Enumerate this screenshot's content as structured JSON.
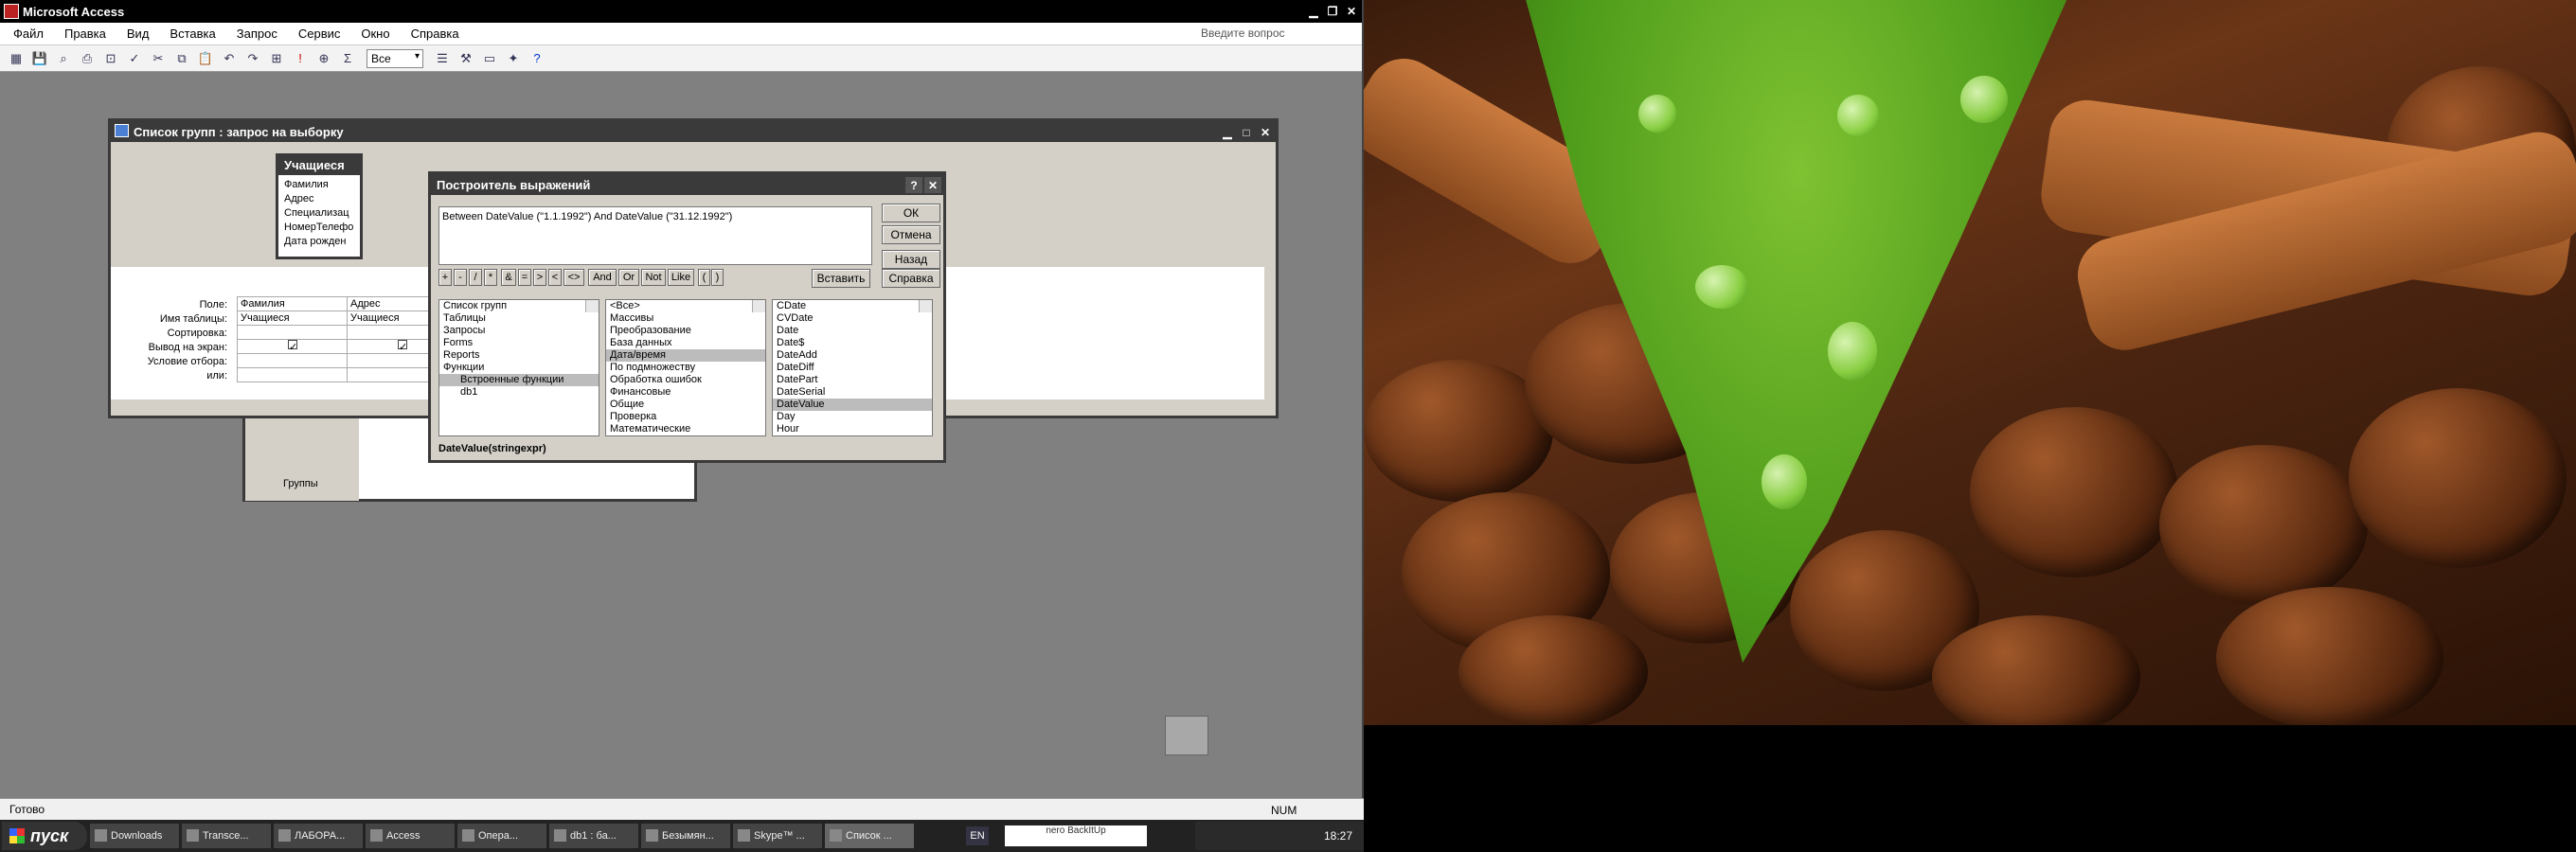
{
  "app": {
    "title": "Microsoft Access",
    "ask_placeholder": "Введите вопрос"
  },
  "menu": [
    "Файл",
    "Правка",
    "Вид",
    "Вставка",
    "Запрос",
    "Сервис",
    "Окно",
    "Справка"
  ],
  "toolbar": {
    "top_values": "Все"
  },
  "query_window": {
    "title": "Список групп : запрос на выборку",
    "table": {
      "name": "Учащиеся",
      "fields": [
        "Фамилия",
        "Адрес",
        "Специализац",
        "НомерТелефо",
        "Дата рожден"
      ]
    },
    "row_labels": [
      "Поле:",
      "Имя таблицы:",
      "Сортировка:",
      "Вывод на экран:",
      "Условие отбора:",
      "или:"
    ],
    "columns": [
      {
        "field": "Фамилия",
        "table": "Учащиеся",
        "show": true
      },
      {
        "field": "Адрес",
        "table": "Учащиеся",
        "show": true
      }
    ]
  },
  "behind_form": {
    "caption": "Группы"
  },
  "builder": {
    "title": "Построитель выражений",
    "expression": "Between DateValue (\"1.1.1992\") And DateValue (\"31.12.1992\")",
    "buttons": {
      "ok": "ОК",
      "cancel": "Отмена",
      "back": "Назад",
      "paste": "Вставить",
      "help": "Справка"
    },
    "operators": [
      "+",
      "-",
      "/",
      "*",
      "&",
      "=",
      ">",
      "<",
      "<>",
      "And",
      "Or",
      "Not",
      "Like",
      "(",
      ")"
    ],
    "folders": [
      "Список групп",
      "Таблицы",
      "Запросы",
      "Forms",
      "Reports",
      "Функции",
      "Встроенные функции",
      "db1"
    ],
    "categories": [
      "<Все>",
      "Массивы",
      "Преобразование",
      "База данных",
      "Дата/время",
      "По подмножеству",
      "Обработка ошибок",
      "Финансовые",
      "Общие",
      "Проверка",
      "Математические"
    ],
    "category_selected": "Дата/время",
    "functions": [
      "CDate",
      "CVDate",
      "Date",
      "Date$",
      "DateAdd",
      "DateDiff",
      "DatePart",
      "DateSerial",
      "DateValue",
      "Day",
      "Hour"
    ],
    "function_selected": "DateValue",
    "syntax": "DateValue(stringexpr)"
  },
  "status": {
    "text": "Готово",
    "num": "NUM"
  },
  "taskbar": {
    "start": "пуск",
    "tasks": [
      "Downloads",
      "Transce...",
      "ЛАБОРА...",
      "Access",
      "Опера...",
      "db1 : ба...",
      "Безымян...",
      "Skype™ ...",
      "Список ..."
    ],
    "lang": "EN",
    "nero": "nero BackItUp",
    "time": "18:27"
  }
}
